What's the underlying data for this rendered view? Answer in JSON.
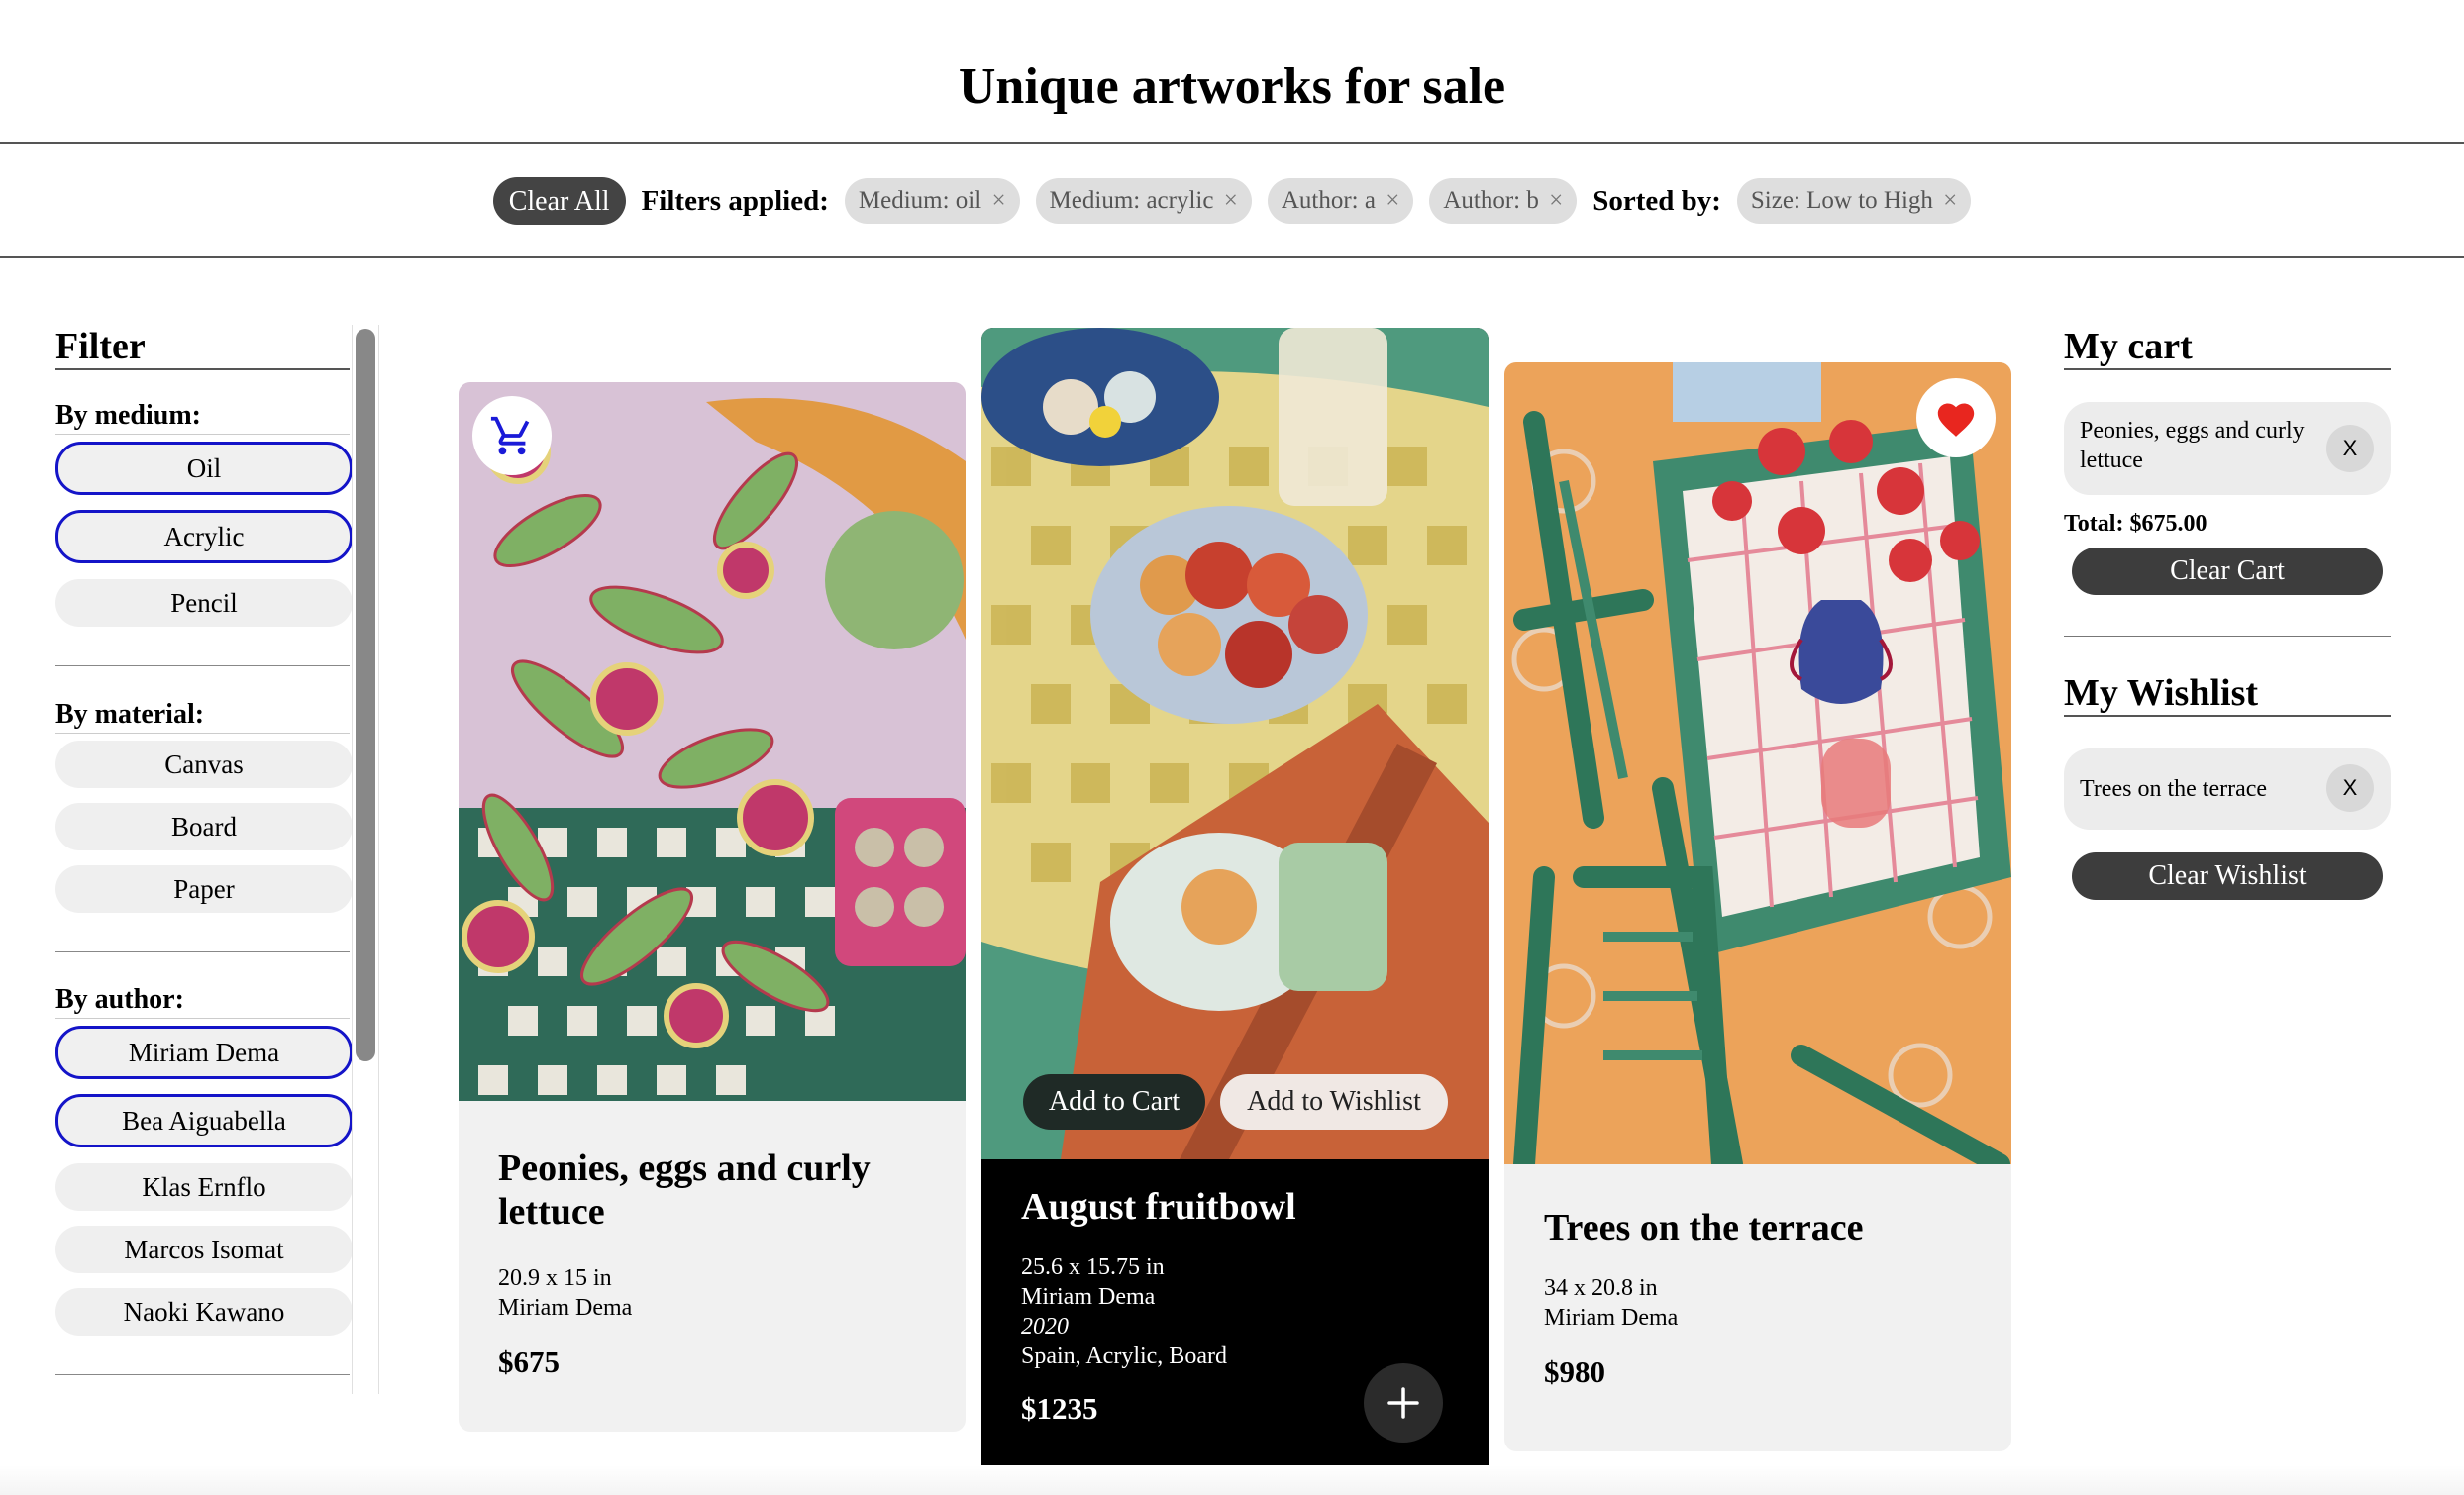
{
  "header": {
    "title": "Unique artworks for sale"
  },
  "filter_bar": {
    "clear_all": "Clear All",
    "filters_label": "Filters applied:",
    "filters": [
      {
        "label": "Medium: oil",
        "x": "×"
      },
      {
        "label": "Medium: acrylic",
        "x": "×"
      },
      {
        "label": "Author: a",
        "x": "×"
      },
      {
        "label": "Author: b",
        "x": "×"
      }
    ],
    "sorted_label": "Sorted by:",
    "sort": {
      "label": "Size: Low to High",
      "x": "×"
    }
  },
  "sidebar": {
    "title": "Filter",
    "medium": {
      "heading": "By medium:",
      "options": [
        "Oil",
        "Acrylic",
        "Pencil"
      ],
      "selected": [
        "Oil",
        "Acrylic"
      ]
    },
    "material": {
      "heading": "By material:",
      "options": [
        "Canvas",
        "Board",
        "Paper"
      ]
    },
    "author": {
      "heading": "By author:",
      "options": [
        "Miriam Dema",
        "Bea Aiguabella",
        "Klas Ernflo",
        "Marcos Isomat",
        "Naoki Kawano"
      ],
      "selected": [
        "Miriam Dema",
        "Bea Aiguabella"
      ]
    }
  },
  "cards": [
    {
      "title": "Peonies, eggs and curly lettuce",
      "size": "20.9 x 15 in",
      "author": "Miriam Dema",
      "price": "$675",
      "badge": "cart-icon"
    },
    {
      "title": "August fruitbowl",
      "size": "25.6 x 15.75 in",
      "author": "Miriam Dema",
      "year": "2020",
      "details": "Spain, Acrylic, Board",
      "price": "$1235",
      "add_to_cart": "Add to Cart",
      "add_to_wishlist": "Add to Wishlist",
      "plus": "+"
    },
    {
      "title": "Trees on the terrace",
      "size": "34 x 20.8 in",
      "author": "Miriam Dema",
      "price": "$980",
      "badge": "heart-icon"
    }
  ],
  "cart": {
    "title": "My cart",
    "items": [
      {
        "label": "Peonies, eggs and curly lettuce",
        "remove": "X"
      }
    ],
    "total": "Total: $675.00",
    "clear": "Clear Cart"
  },
  "wishlist": {
    "title": "My Wishlist",
    "items": [
      {
        "label": "Trees on the terrace",
        "remove": "X"
      }
    ],
    "clear": "Clear Wishlist"
  },
  "colors": {
    "selected_border": "#1414c8",
    "heart": "#e8261f",
    "cart_icon": "#1a1ad8",
    "dark_button": "#3d3d3d"
  }
}
